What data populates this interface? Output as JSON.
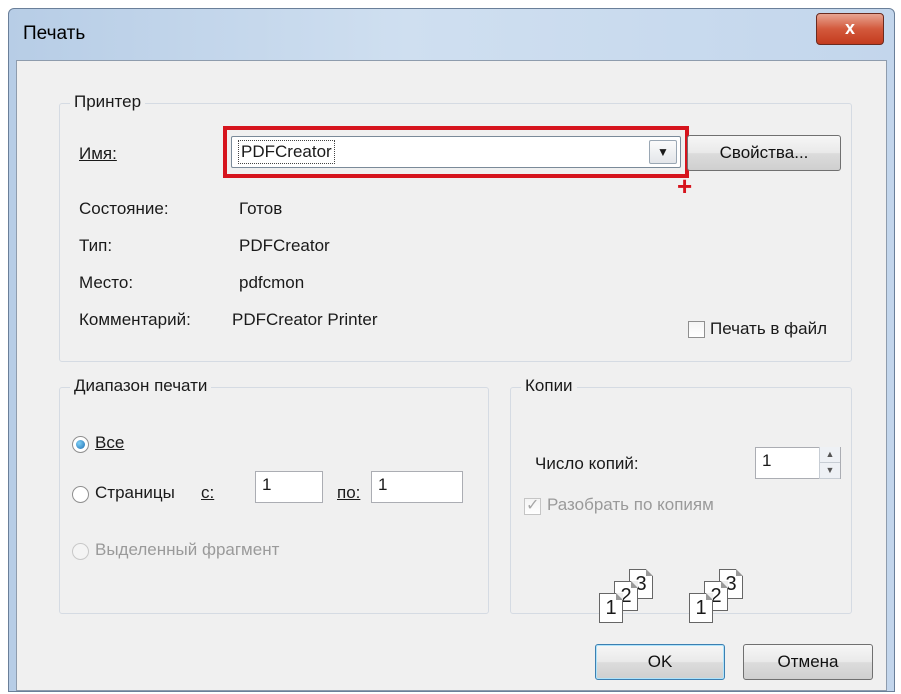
{
  "window": {
    "title": "Печать",
    "close_label": "x"
  },
  "printer": {
    "group_title": "Принтер",
    "name_label": "Имя:",
    "name_value": "PDFCreator",
    "properties_button": "Свойства...",
    "status_label": "Состояние:",
    "status_value": "Готов",
    "type_label": "Тип:",
    "type_value": "PDFCreator",
    "place_label": "Место:",
    "place_value": "pdfcmon",
    "comment_label": "Комментарий:",
    "comment_value": "PDFCreator Printer",
    "print_to_file_label": "Печать в файл"
  },
  "range": {
    "group_title": "Диапазон печати",
    "all_label": "Все",
    "pages_label": "Страницы",
    "from_label": "с:",
    "from_value": "1",
    "to_label": "по:",
    "to_value": "1",
    "selection_label": "Выделенный фрагмент"
  },
  "copies": {
    "group_title": "Копии",
    "count_label": "Число копий:",
    "count_value": "1",
    "collate_label": "Разобрать по копиям",
    "collate_pages": [
      "1",
      "2",
      "3",
      "1",
      "2",
      "3"
    ]
  },
  "buttons": {
    "ok": "OK",
    "cancel": "Отмена"
  },
  "annotation": {
    "marker": "+"
  },
  "icons": {
    "close": "close-icon",
    "dropdown": "chevron-down-icon",
    "spin_up": "arrow-up-icon",
    "spin_down": "arrow-down-icon"
  },
  "colors": {
    "highlight": "#d6141d",
    "accent": "#1f6fb2"
  }
}
